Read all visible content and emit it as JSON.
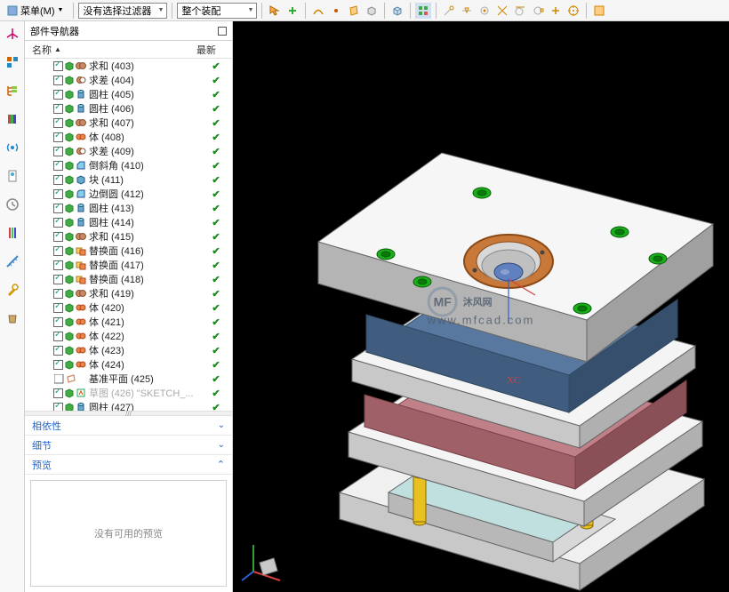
{
  "topbar": {
    "menu_label": "菜单(M)",
    "filter_dd": "没有选择过滤器",
    "assembly_dd": "整个装配"
  },
  "sidebar": {
    "title": "部件导航器",
    "col_name": "名称",
    "col_latest": "最新",
    "splitter": "///"
  },
  "tree": [
    {
      "label": "求和 (403)",
      "icon1": "green-cube",
      "icon2": "union",
      "check": true
    },
    {
      "label": "求差 (404)",
      "icon1": "green-cube",
      "icon2": "subtract",
      "check": true
    },
    {
      "label": "圆柱 (405)",
      "icon1": "green-cube",
      "icon2": "cyl-blue",
      "check": true
    },
    {
      "label": "圆柱 (406)",
      "icon1": "green-cube",
      "icon2": "cyl-blue",
      "check": true
    },
    {
      "label": "求和 (407)",
      "icon1": "green-cube",
      "icon2": "union",
      "check": true
    },
    {
      "label": "体 (408)",
      "icon1": "green-cube",
      "icon2": "body-orange",
      "check": true
    },
    {
      "label": "求差 (409)",
      "icon1": "green-cube",
      "icon2": "subtract",
      "check": true
    },
    {
      "label": "倒斜角 (410)",
      "icon1": "green-cube",
      "icon2": "chamfer",
      "check": true
    },
    {
      "label": "块 (411)",
      "icon1": "green-cube",
      "icon2": "block-blue",
      "check": true
    },
    {
      "label": "边倒圆 (412)",
      "icon1": "green-cube",
      "icon2": "fillet",
      "check": true
    },
    {
      "label": "圆柱 (413)",
      "icon1": "green-cube",
      "icon2": "cyl-blue",
      "check": true
    },
    {
      "label": "圆柱 (414)",
      "icon1": "green-cube",
      "icon2": "cyl-blue",
      "check": true
    },
    {
      "label": "求和 (415)",
      "icon1": "green-cube",
      "icon2": "union",
      "check": true
    },
    {
      "label": "替换面 (416)",
      "icon1": "green-cube",
      "icon2": "replace-face",
      "check": true
    },
    {
      "label": "替换面 (417)",
      "icon1": "green-cube",
      "icon2": "replace-face",
      "check": true
    },
    {
      "label": "替换面 (418)",
      "icon1": "green-cube",
      "icon2": "replace-face",
      "check": true
    },
    {
      "label": "求和 (419)",
      "icon1": "green-cube",
      "icon2": "union",
      "check": true
    },
    {
      "label": "体 (420)",
      "icon1": "green-cube",
      "icon2": "body-orange",
      "check": true
    },
    {
      "label": "体 (421)",
      "icon1": "green-cube",
      "icon2": "body-orange",
      "check": true
    },
    {
      "label": "体 (422)",
      "icon1": "green-cube",
      "icon2": "body-orange",
      "check": true
    },
    {
      "label": "体 (423)",
      "icon1": "green-cube",
      "icon2": "body-orange",
      "check": true
    },
    {
      "label": "体 (424)",
      "icon1": "green-cube",
      "icon2": "body-orange",
      "check": true
    },
    {
      "label": "基准平面 (425)",
      "icon1": "chk-off",
      "icon2": "plane",
      "check": true
    },
    {
      "label": "草图 (426) \"SKETCH_...",
      "icon1": "green-cube",
      "icon2": "sketch",
      "check": true,
      "dim": true
    },
    {
      "label": "圆柱 (427)",
      "icon1": "green-cube",
      "icon2": "cyl-blue",
      "check": true
    }
  ],
  "sections": {
    "dependency": "相依性",
    "details": "细节",
    "preview": "预览",
    "preview_empty": "没有可用的预览"
  },
  "viewport": {
    "axis_xc": "XC",
    "watermark_text": "沐风网",
    "watermark_sub": "www.mfcad.com",
    "watermark_logo": "MF"
  }
}
